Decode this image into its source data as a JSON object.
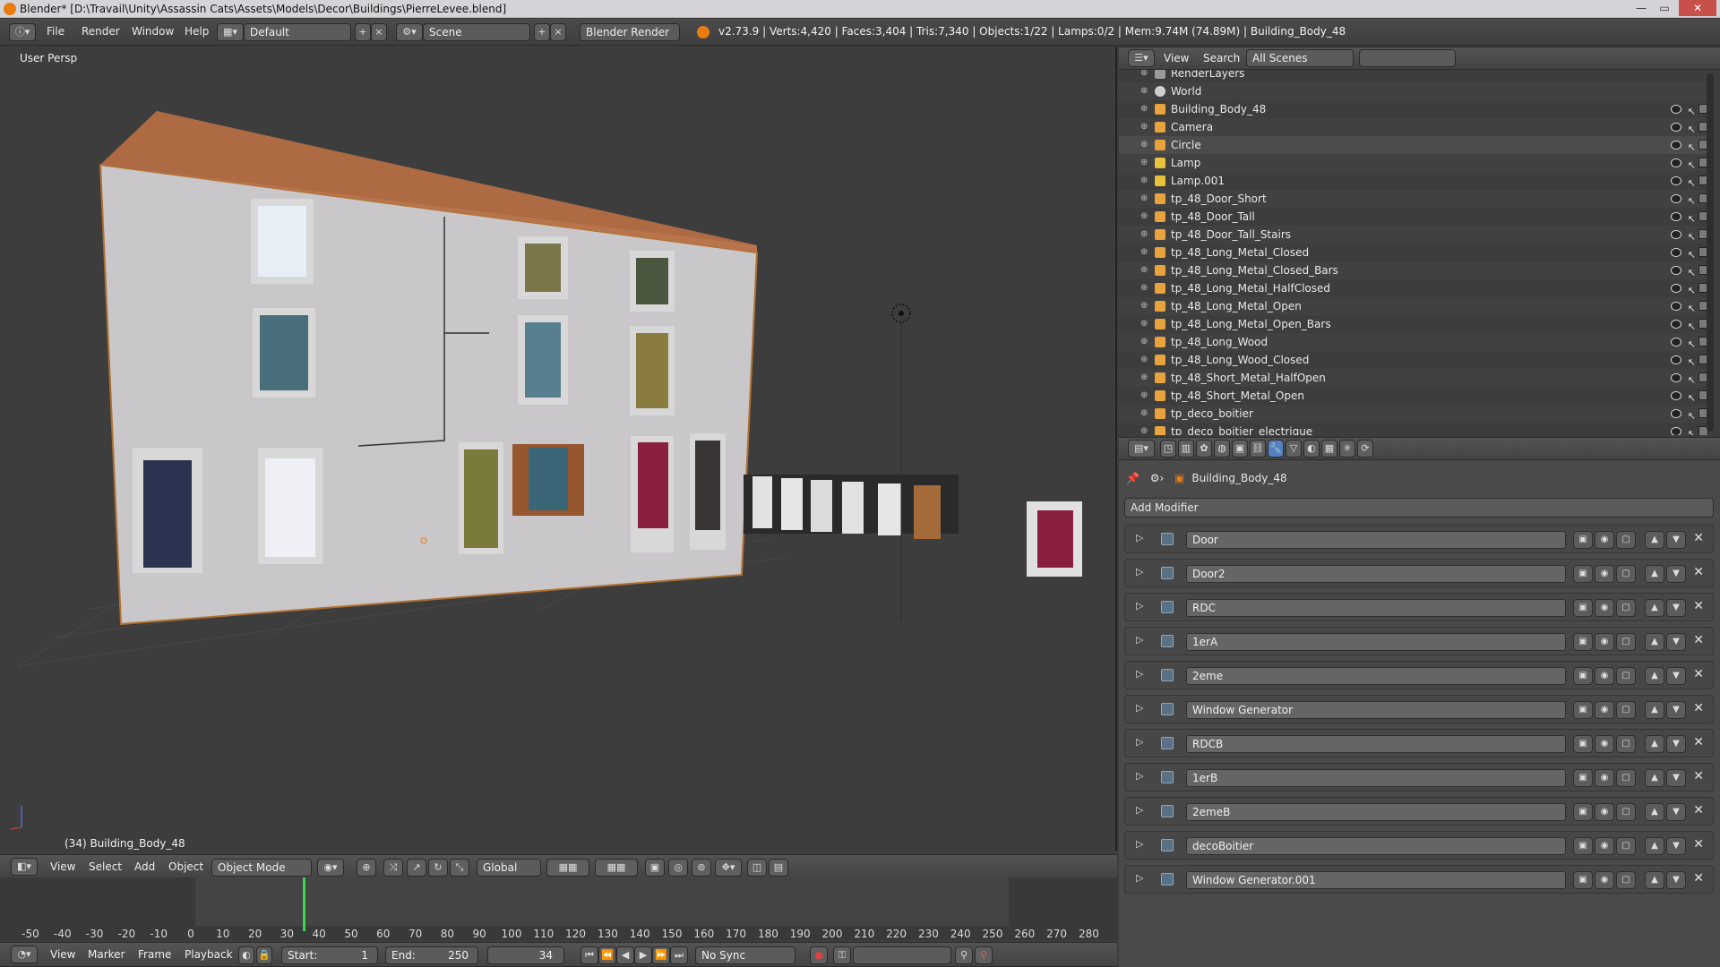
{
  "window": {
    "title": "Blender* [D:\\Travail\\Unity\\Assassin Cats\\Assets\\Models\\Decor\\Buildings\\PierreLevee.blend]",
    "minimize": "—",
    "maximize": "▭",
    "close": "✕"
  },
  "topbar": {
    "menu": [
      "File",
      "Render",
      "Window",
      "Help"
    ],
    "layout_value": "Default",
    "scene_value": "Scene",
    "engine_value": "Blender Render",
    "stats": "v2.73.9 | Verts:4,420 | Faces:3,404 | Tris:7,340 | Objects:1/22 | Lamps:0/2 | Mem:9.74M (74.89M) | Building_Body_48"
  },
  "viewport": {
    "view_label": "User Persp",
    "object_label": "(34) Building_Body_48",
    "header": {
      "menus": [
        "View",
        "Select",
        "Add",
        "Object"
      ],
      "mode_value": "Object Mode",
      "orientation_value": "Global"
    }
  },
  "timeline": {
    "ticks": [
      "-50",
      "-40",
      "-30",
      "-20",
      "-10",
      "0",
      "10",
      "20",
      "30",
      "40",
      "50",
      "60",
      "70",
      "80",
      "90",
      "100",
      "110",
      "120",
      "130",
      "140",
      "150",
      "160",
      "170",
      "180",
      "190",
      "200",
      "210",
      "220",
      "230",
      "240",
      "250",
      "260",
      "270",
      "280"
    ],
    "current_frame_marker": 34,
    "header": {
      "menus": [
        "View",
        "Marker",
        "Frame",
        "Playback"
      ],
      "start_label": "Start:",
      "start_value": "1",
      "end_label": "End:",
      "end_value": "250",
      "current_value": "34",
      "sync_value": "No Sync"
    }
  },
  "outliner": {
    "header": {
      "menus": [
        "View",
        "Search"
      ],
      "filter_value": "All Scenes",
      "search_placeholder": ""
    },
    "rows": [
      {
        "name": "RenderLayers",
        "icon": "renderlayers-icon"
      },
      {
        "name": "World",
        "icon": "world-icon"
      },
      {
        "name": "Building_Body_48",
        "icon": "mesh-icon"
      },
      {
        "name": "Camera",
        "icon": "camera-icon"
      },
      {
        "name": "Circle",
        "icon": "curve-icon"
      },
      {
        "name": "Lamp",
        "icon": "lamp-icon"
      },
      {
        "name": "Lamp.001",
        "icon": "lamp-icon"
      },
      {
        "name": "tp_48_Door_Short",
        "icon": "mesh-icon"
      },
      {
        "name": "tp_48_Door_Tall",
        "icon": "mesh-icon"
      },
      {
        "name": "tp_48_Door_Tall_Stairs",
        "icon": "mesh-icon"
      },
      {
        "name": "tp_48_Long_Metal_Closed",
        "icon": "mesh-icon"
      },
      {
        "name": "tp_48_Long_Metal_Closed_Bars",
        "icon": "mesh-icon"
      },
      {
        "name": "tp_48_Long_Metal_HalfClosed",
        "icon": "mesh-icon"
      },
      {
        "name": "tp_48_Long_Metal_Open",
        "icon": "mesh-icon"
      },
      {
        "name": "tp_48_Long_Metal_Open_Bars",
        "icon": "mesh-icon"
      },
      {
        "name": "tp_48_Long_Wood",
        "icon": "mesh-icon"
      },
      {
        "name": "tp_48_Long_Wood_Closed",
        "icon": "mesh-icon"
      },
      {
        "name": "tp_48_Short_Metal_HalfOpen",
        "icon": "mesh-icon"
      },
      {
        "name": "tp_48_Short_Metal_Open",
        "icon": "mesh-icon"
      },
      {
        "name": "tp_deco_boitier",
        "icon": "mesh-icon"
      },
      {
        "name": "tp_deco_boitier_electrique",
        "icon": "mesh-icon"
      }
    ]
  },
  "properties": {
    "breadcrumb_object": "Building_Body_48",
    "add_modifier_label": "Add Modifier",
    "modifiers": [
      "Door",
      "Door2",
      "RDC",
      "1erA",
      "2eme",
      "Window Generator",
      "RDCB",
      "1erB",
      "2emeB",
      "decoBoitier",
      "Window Generator.001"
    ]
  },
  "colors": {
    "accent_orange": "#e87d0d",
    "selection_blue": "#5680c2",
    "panel_bg": "#4a4a4a",
    "viewport_bg": "#3d3d3d"
  }
}
